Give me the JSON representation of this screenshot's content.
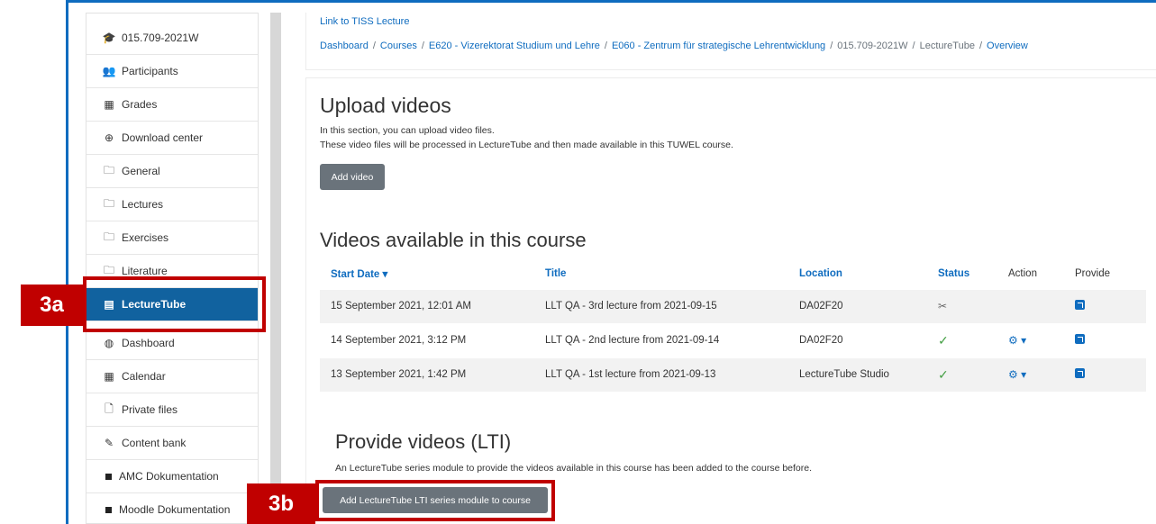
{
  "header": {
    "tiss_link": "Link to TISS Lecture",
    "breadcrumb": [
      "Dashboard",
      "Courses",
      "E620 - Vizerektorat Studium und Lehre",
      "E060 - Zentrum für strategische Lehrentwicklung",
      "015.709-2021W",
      "LectureTube",
      "Overview"
    ]
  },
  "sidebar": {
    "items": [
      {
        "label": "015.709-2021W",
        "icon": "graduation-cap-icon",
        "glyph": "🎓"
      },
      {
        "label": "Participants",
        "icon": "users-icon",
        "glyph": "👥"
      },
      {
        "label": "Grades",
        "icon": "table-icon",
        "glyph": "▦"
      },
      {
        "label": "Download center",
        "icon": "download-circle-icon",
        "glyph": "⊕"
      },
      {
        "label": "General",
        "icon": "folder-icon",
        "glyph": "🗀"
      },
      {
        "label": "Lectures",
        "icon": "folder-icon",
        "glyph": "🗀"
      },
      {
        "label": "Exercises",
        "icon": "folder-icon",
        "glyph": "🗀"
      },
      {
        "label": "Literature",
        "icon": "folder-icon",
        "glyph": "🗀"
      },
      {
        "label": "LectureTube",
        "icon": "film-icon",
        "glyph": "▤"
      },
      {
        "label": "Dashboard",
        "icon": "dashboard-icon",
        "glyph": "◍"
      },
      {
        "label": "Calendar",
        "icon": "calendar-icon",
        "glyph": "▦"
      },
      {
        "label": "Private files",
        "icon": "file-icon",
        "glyph": "🗋"
      },
      {
        "label": "Content bank",
        "icon": "brush-icon",
        "glyph": "✎"
      },
      {
        "label": "AMC Dokumentation",
        "icon": "square-icon",
        "glyph": ""
      },
      {
        "label": "Moodle Dokumentation",
        "icon": "square-icon",
        "glyph": ""
      }
    ]
  },
  "upload": {
    "title": "Upload videos",
    "desc1": "In this section, you can upload video files.",
    "desc2": "These video files will be processed in LectureTube and then made available in this TUWEL course.",
    "button": "Add video"
  },
  "videos": {
    "title": "Videos available in this course",
    "columns": [
      "Start Date",
      "Title",
      "Location",
      "Status",
      "Action",
      "Provide"
    ],
    "sort_indicator": "▾",
    "rows": [
      {
        "date": "15 September 2021, 12:01 AM",
        "title": "LLT QA - 3rd lecture from 2021-09-15",
        "location": "DA02F20",
        "status": "processing",
        "status_glyph": "✂",
        "action": ""
      },
      {
        "date": "14 September 2021, 3:12 PM",
        "title": "LLT QA - 2nd lecture from 2021-09-14",
        "location": "DA02F20",
        "status": "done",
        "status_glyph": "✓",
        "action": "⚙ ▾"
      },
      {
        "date": "13 September 2021, 1:42 PM",
        "title": "LLT QA - 1st lecture from 2021-09-13",
        "location": "LectureTube Studio",
        "status": "done",
        "status_glyph": "✓",
        "action": "⚙ ▾"
      }
    ]
  },
  "provide": {
    "title": "Provide videos (LTI)",
    "desc": "An LectureTube series module to provide the videos available in this course has been added to the course before.",
    "button": "Add LectureTube LTI series module to course"
  },
  "annotations": {
    "a": "3a",
    "b": "3b",
    "color": "#c00000"
  },
  "colors": {
    "accent": "#0f6cbf",
    "active_bg": "#11629f",
    "button_bg": "#6a737b"
  }
}
